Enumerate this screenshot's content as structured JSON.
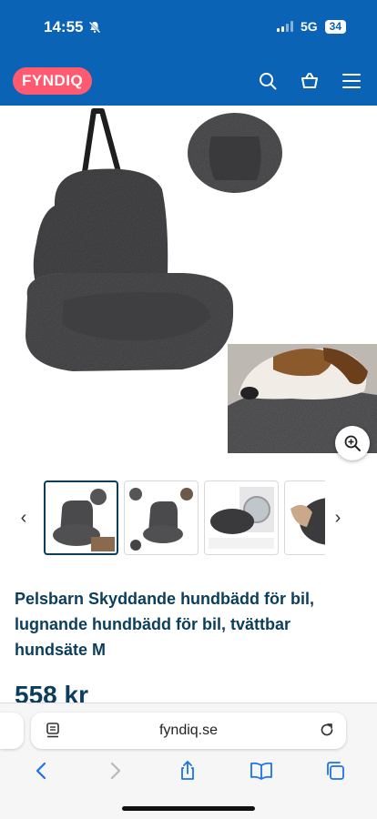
{
  "status": {
    "time": "14:55",
    "network": "5G",
    "battery": "34"
  },
  "header": {
    "logo": "FYNDIQ"
  },
  "product": {
    "title": "Pelsbarn Skyddande hundbädd för bil, lugnande hundbädd för bil, tvättbar hundsäte M",
    "price": "558 kr"
  },
  "browser": {
    "url": "fyndiq.se"
  },
  "colors": {
    "brand_blue": "#0b63b6",
    "logo_pink": "#ff5a70",
    "text_navy": "#0b3d5c"
  }
}
